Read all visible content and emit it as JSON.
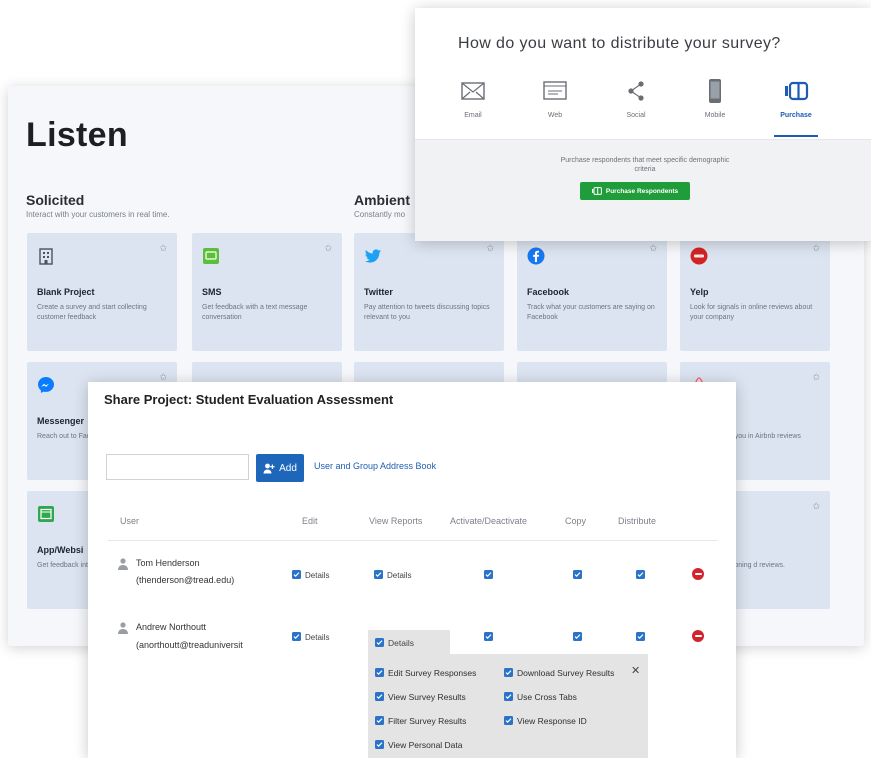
{
  "listen": {
    "title": "Listen",
    "solicited": {
      "heading": "Solicited",
      "subtitle": "Interact with your customers in real time."
    },
    "ambient": {
      "heading": "Ambient",
      "subtitle": "Constantly mo"
    },
    "cards": [
      {
        "title": "Blank Project",
        "desc": "Create a survey and start collecting customer feedback",
        "icon": "building-icon"
      },
      {
        "title": "SMS",
        "desc": "Get feedback with a text message conversation",
        "icon": "sms-icon"
      },
      {
        "title": "Twitter",
        "desc": "Pay attention to tweets discussing topics relevant to you",
        "icon": "twitter-icon"
      },
      {
        "title": "Facebook",
        "desc": "Track what your customers are saying on Facebook",
        "icon": "facebook-icon"
      },
      {
        "title": "Yelp",
        "desc": "Look for signals in online reviews about your company",
        "icon": "yelp-icon"
      },
      {
        "title": "Messenger",
        "desc": "Reach out to Facebook Me",
        "icon": "messenger-icon"
      },
      {
        "title": "",
        "desc": "",
        "icon": ""
      },
      {
        "title": "",
        "desc": "",
        "icon": ""
      },
      {
        "title": "",
        "desc": "",
        "icon": ""
      },
      {
        "title": "",
        "desc": "ee people are you in Airbnb reviews",
        "icon": "airbnb-icon"
      },
      {
        "title": "App/Websi",
        "desc": "Get feedback interact with",
        "icon": "app-icon"
      },
      {
        "title": "",
        "desc": "",
        "icon": ""
      },
      {
        "title": "",
        "desc": "",
        "icon": ""
      },
      {
        "title": "",
        "desc": "",
        "icon": ""
      },
      {
        "title": "",
        "desc": "ople are mentioning d reviews.",
        "icon": ""
      }
    ]
  },
  "distribute": {
    "question": "How do you want to distribute your survey?",
    "options": [
      {
        "label": "Email",
        "icon": "envelope-icon"
      },
      {
        "label": "Web",
        "icon": "web-icon"
      },
      {
        "label": "Social",
        "icon": "share-icon"
      },
      {
        "label": "Mobile",
        "icon": "mobile-icon"
      },
      {
        "label": "Purchase",
        "icon": "purchase-icon"
      }
    ],
    "active": "Purchase",
    "description": "Purchase respondents that meet specific demographic criteria",
    "button": "Purchase Respondents",
    "colors": {
      "accent": "#1e5bb5",
      "button": "#1f9d3a"
    }
  },
  "share": {
    "title": "Share Project: Student Evaluation Assessment",
    "input_value": "",
    "add_label": "Add",
    "address_book": "User and Group Address Book",
    "columns": [
      "User",
      "Edit",
      "View Reports",
      "Activate/Deactivate",
      "Copy",
      "Distribute"
    ],
    "details_label": "Details",
    "users": [
      {
        "name": "Tom Henderson",
        "email": "(thenderson@tread.edu)"
      },
      {
        "name": "Andrew Northoutt",
        "email": "(anorthoutt@treaduniversit"
      }
    ],
    "permissions": [
      "Edit Survey Responses",
      "Download Survey Results",
      "View Survey Results",
      "Use Cross Tabs",
      "Filter Survey Results",
      "View Response ID",
      "View Personal Data"
    ],
    "close_glyph": "✕"
  }
}
